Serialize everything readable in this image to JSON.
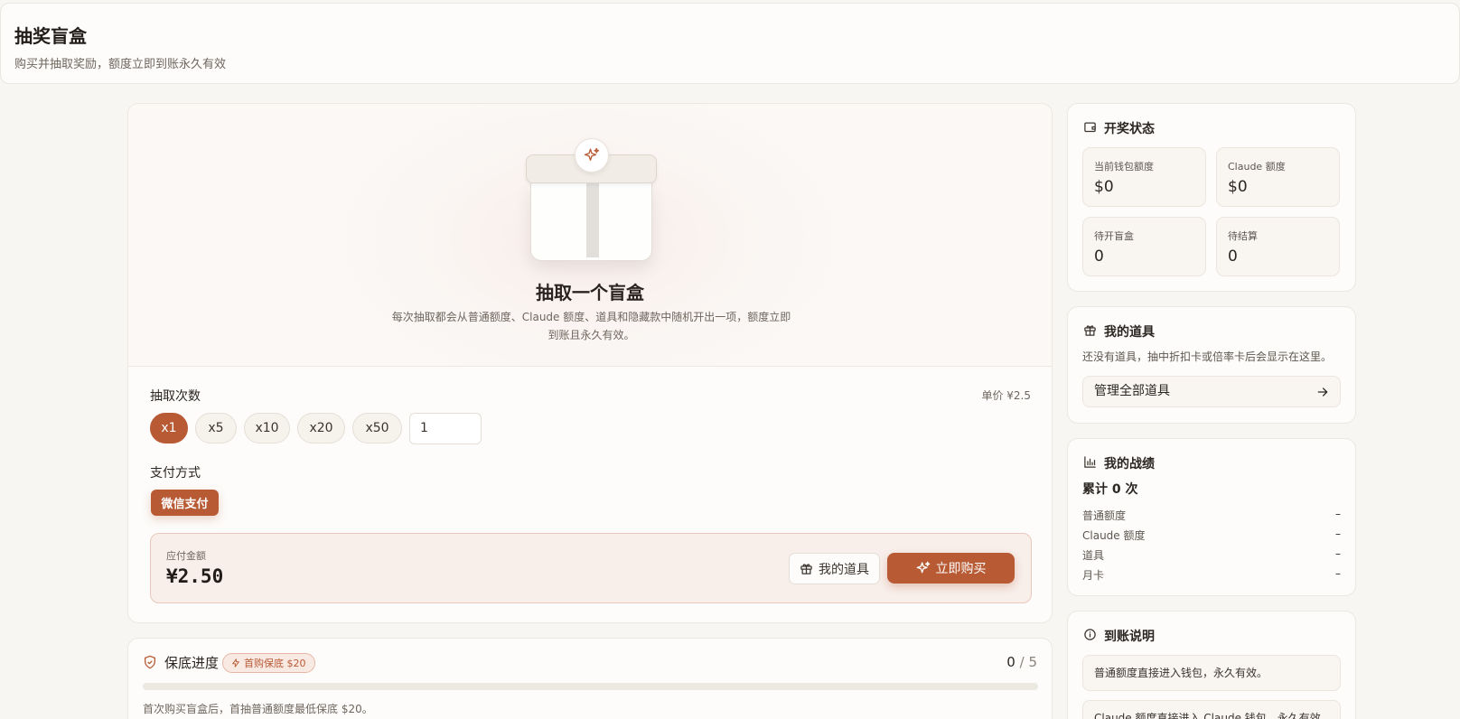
{
  "header": {
    "title": "抽奖盲盒",
    "subtitle": "购买并抽取奖励，额度立即到账永久有效"
  },
  "hero": {
    "title": "抽取一个盲盒",
    "desc": "每次抽取都会从普通额度、Claude 额度、道具和隐藏款中随机开出一项，额度立即到账且永久有效。"
  },
  "draw": {
    "count_label": "抽取次数",
    "unit_price": "单价 ¥2.5",
    "options": [
      "x1",
      "x5",
      "x10",
      "x20",
      "x50"
    ],
    "selected": "x1",
    "custom_qty": "1",
    "payment_label": "支付方式",
    "payment_method": "微信支付",
    "amount_label": "应付金额",
    "amount": "¥2.50",
    "my_items_button": "我的道具",
    "buy_button": "立即购买"
  },
  "guarantee": {
    "title": "保底进度",
    "badge": "首购保底 $20",
    "current": "0",
    "separator": "/",
    "total": "5",
    "progress_fraction": 0,
    "desc": "首次购买盲盒后，首抽普通额度最低保底 $20。"
  },
  "status": {
    "title": "开奖状态",
    "stats": [
      {
        "label": "当前钱包额度",
        "value": "$0"
      },
      {
        "label": "Claude 额度",
        "value": "$0"
      },
      {
        "label": "待开盲盒",
        "value": "0"
      },
      {
        "label": "待结算",
        "value": "0"
      }
    ]
  },
  "items": {
    "title": "我的道具",
    "empty_text": "还没有道具，抽中折扣卡或倍率卡后会显示在这里。",
    "manage_button": "管理全部道具"
  },
  "record": {
    "title": "我的战绩",
    "total": "累计 0 次",
    "rows": [
      {
        "label": "普通额度",
        "value": "–"
      },
      {
        "label": "Claude 额度",
        "value": "–"
      },
      {
        "label": "道具",
        "value": "–"
      },
      {
        "label": "月卡",
        "value": "–"
      }
    ]
  },
  "arrival": {
    "title": "到账说明",
    "notes": [
      "普通额度直接进入钱包，永久有效。",
      "Claude 额度直接进入 Claude 钱包，永久有效。"
    ]
  },
  "colors": {
    "accent": "#b85a34",
    "background": "#f8f6f2",
    "card": "#fdfcfa"
  }
}
